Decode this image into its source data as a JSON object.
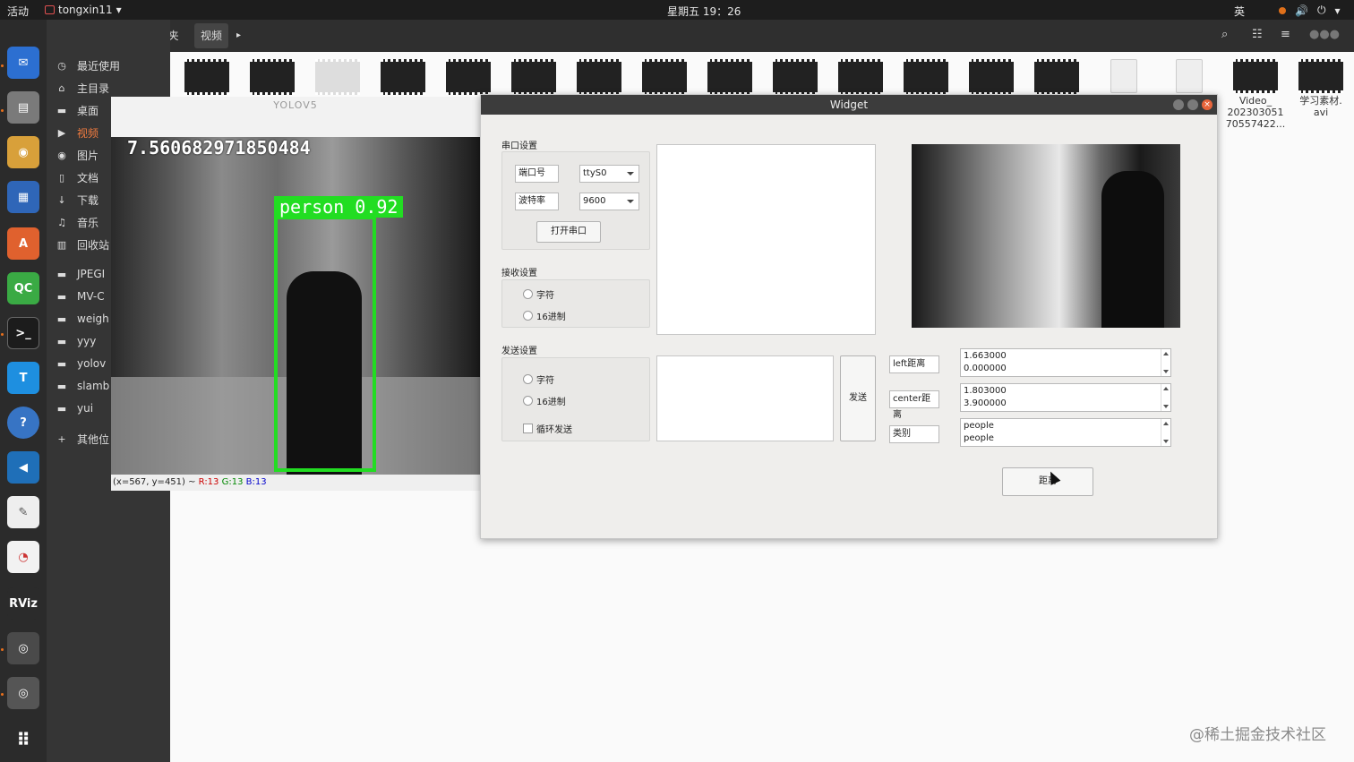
{
  "topbar": {
    "activities": "活动",
    "app_name": "tongxin11",
    "clock": "星期五 19：26",
    "ime": "英"
  },
  "fm": {
    "crumb_home": "主文件夹",
    "crumb_current": "视频",
    "sidebar": [
      {
        "label": "最近使用",
        "icon": "clock-icon",
        "glyph": "◷"
      },
      {
        "label": "主目录",
        "icon": "home-icon",
        "glyph": "⌂"
      },
      {
        "label": "桌面",
        "icon": "folder-icon",
        "glyph": "▬"
      },
      {
        "label": "视频",
        "icon": "video-icon",
        "glyph": "▶",
        "active": true
      },
      {
        "label": "图片",
        "icon": "camera-icon",
        "glyph": "◉"
      },
      {
        "label": "文档",
        "icon": "document-icon",
        "glyph": "▯"
      },
      {
        "label": "下载",
        "icon": "download-icon",
        "glyph": "↓"
      },
      {
        "label": "音乐",
        "icon": "music-icon",
        "glyph": "♫"
      },
      {
        "label": "回收站",
        "icon": "trash-icon",
        "glyph": "▥"
      },
      {
        "label": "JPEGI",
        "icon": "folder-icon",
        "glyph": "▬"
      },
      {
        "label": "MV-C",
        "icon": "folder-icon",
        "glyph": "▬"
      },
      {
        "label": "weigh",
        "icon": "folder-icon",
        "glyph": "▬"
      },
      {
        "label": "yyy",
        "icon": "folder-icon",
        "glyph": "▬"
      },
      {
        "label": "yolov",
        "icon": "folder-icon",
        "glyph": "▬"
      },
      {
        "label": "slamb",
        "icon": "folder-icon",
        "glyph": "▬"
      },
      {
        "label": "yui",
        "icon": "folder-icon",
        "glyph": "▬"
      },
      {
        "label": "其他位",
        "icon": "plus-icon",
        "glyph": "+"
      }
    ],
    "files": [
      {
        "label": "Video_\n202303051\n70557422..."
      },
      {
        "label": "学习素材.\navi"
      }
    ]
  },
  "yolo": {
    "title": "YOLOV5",
    "fps": "7.560682971850484",
    "det_label": "person  0.92",
    "status_prefix": "(x=567, y=451) ~ ",
    "status_r": "R:13",
    "status_g": "G:13",
    "status_b": "B:13"
  },
  "widget": {
    "title": "Widget",
    "serial": {
      "group": "串口设置",
      "port_label": "端口号",
      "port_value": "ttyS0",
      "baud_label": "波特率",
      "baud_value": "9600",
      "open_btn": "打开串口"
    },
    "receive": {
      "group": "接收设置",
      "opt_char": "字符",
      "opt_hex": "16进制"
    },
    "send": {
      "group": "发送设置",
      "opt_char": "字符",
      "opt_hex": "16进制",
      "loop": "循环发送",
      "send_btn": "发送"
    },
    "fields": [
      {
        "label": "left距离",
        "line1": "1.663000",
        "line2": "0.000000"
      },
      {
        "label": "center距离",
        "line1": "1.803000",
        "line2": "3.900000"
      },
      {
        "label": "类别",
        "line1": "people",
        "line2": "people"
      }
    ],
    "distance_btn": "距离"
  },
  "watermark": "@稀土掘金技术社区",
  "colors": {
    "accent": "#f07b3f",
    "detect": "#22dd22",
    "status_r": "#cc0000",
    "status_g": "#008800",
    "status_b": "#0000cc"
  }
}
